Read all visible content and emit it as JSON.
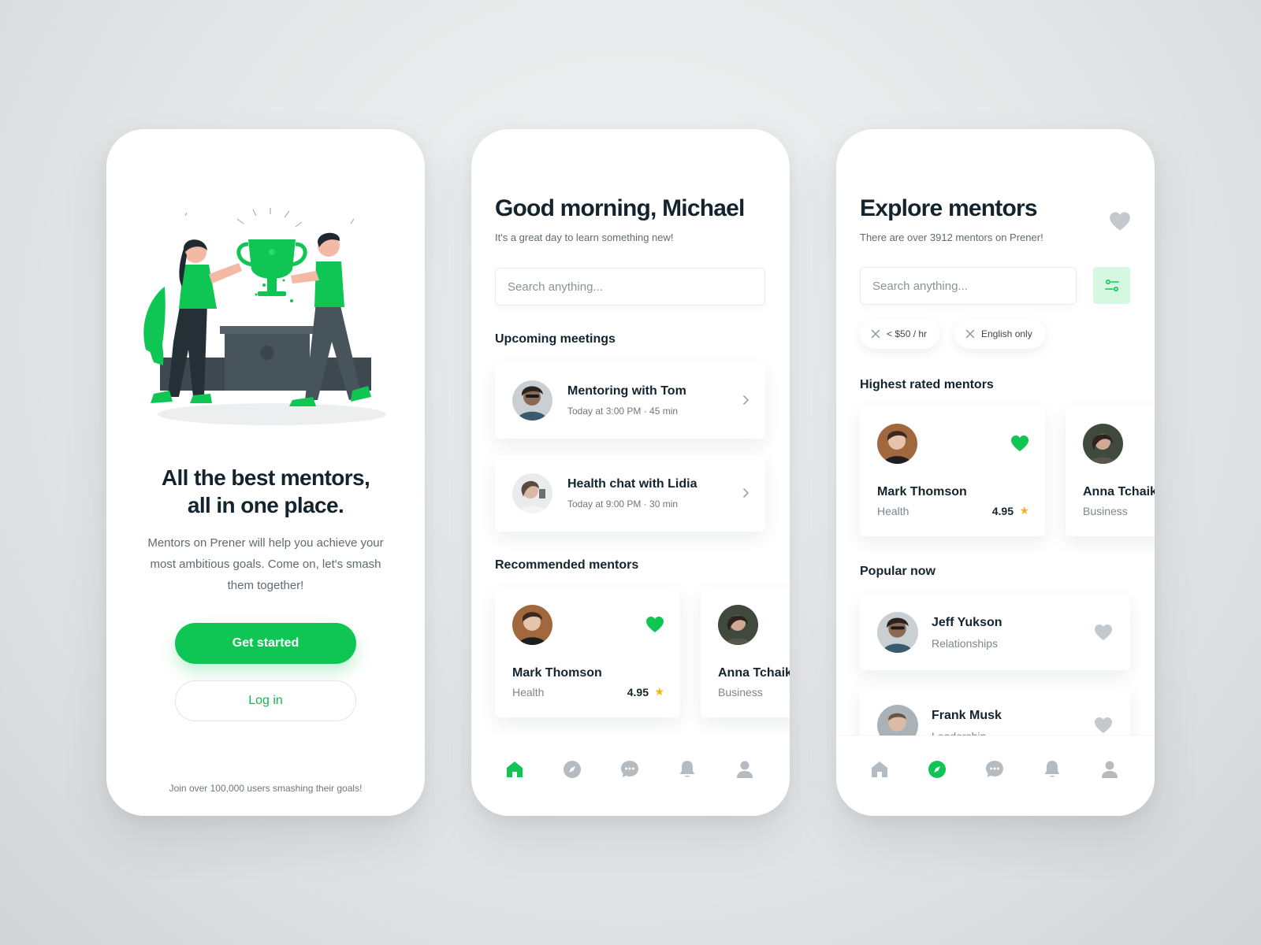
{
  "onboarding": {
    "title": "All the best mentors,\nall in one place.",
    "description": "Mentors on Prener will help you achieve your most ambitious goals. Come on, let's smash them together!",
    "get_started": "Get started",
    "login": "Log in",
    "footnote": "Join over 100,000 users smashing their goals!"
  },
  "home": {
    "greeting": "Good morning, Michael",
    "subtitle": "It's a great day to learn something new!",
    "search_placeholder": "Search anything...",
    "upcoming_title": "Upcoming meetings",
    "meetings": [
      {
        "title": "Mentoring with Tom",
        "time": "Today at 3:00 PM · 45 min"
      },
      {
        "title": "Health chat with Lidia",
        "time": "Today at 9:00 PM · 30 min"
      }
    ],
    "recommended_title": "Recommended mentors",
    "mentors": [
      {
        "name": "Mark Thomson",
        "category": "Health",
        "rating": "4.95",
        "favorited": true
      },
      {
        "name": "Anna Tchaikovsky",
        "category": "Business"
      }
    ],
    "active_tab": "home"
  },
  "explore": {
    "title": "Explore mentors",
    "subtitle": "There are over 3912 mentors on Prener!",
    "search_placeholder": "Search anything...",
    "filters": [
      "< $50 / hr",
      "English only"
    ],
    "highest_title": "Highest rated mentors",
    "highest": [
      {
        "name": "Mark Thomson",
        "category": "Health",
        "rating": "4.95",
        "favorited": true
      },
      {
        "name": "Anna Tchaikovsky",
        "category": "Business"
      }
    ],
    "popular_title": "Popular now",
    "popular": [
      {
        "name": "Jeff Yukson",
        "category": "Relationships"
      },
      {
        "name": "Frank Musk",
        "category": "Leadership"
      }
    ],
    "active_tab": "explore"
  },
  "colors": {
    "accent": "#0fc654",
    "accent_light": "#d6f7e1",
    "text_dark": "#14242e",
    "text_muted": "#6d767c",
    "tab_inactive": "#b5bcc1",
    "star": "#f5b316"
  },
  "icons": {
    "tabs": [
      "home-icon",
      "compass-icon",
      "chat-icon",
      "bell-icon",
      "profile-icon"
    ]
  }
}
